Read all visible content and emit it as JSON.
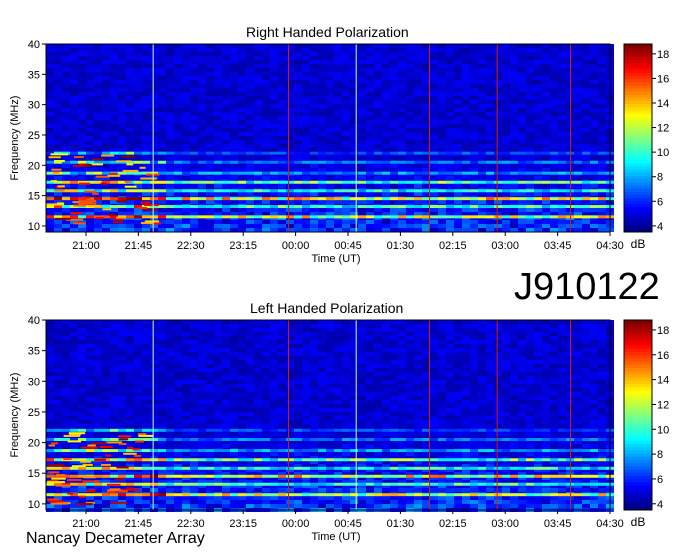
{
  "observation_id": "J910122",
  "instrument": "Nancay Decameter Array",
  "colorbar_unit": "dB",
  "chart_data": [
    {
      "type": "heatmap",
      "title": "Right Handed Polarization",
      "xlabel": "Time (UT)",
      "ylabel": "Frequency (MHz)",
      "x_ticks": [
        "21:00",
        "21:45",
        "22:30",
        "23:15",
        "00:00",
        "00:45",
        "01:30",
        "02:15",
        "03:00",
        "03:45",
        "04:30"
      ],
      "y_ticks": [
        10,
        15,
        20,
        25,
        30,
        35,
        40
      ],
      "ylim": [
        9,
        40
      ],
      "colorbar_ticks": [
        4,
        6,
        8,
        10,
        12,
        14,
        16,
        18
      ],
      "colorbar_range": [
        3.5,
        18.8
      ]
    },
    {
      "type": "heatmap",
      "title": "Left Handed Polarization",
      "xlabel": "Time (UT)",
      "ylabel": "Frequency (MHz)",
      "x_ticks": [
        "21:00",
        "21:45",
        "22:30",
        "23:15",
        "00:00",
        "00:45",
        "01:30",
        "02:15",
        "03:00",
        "03:45",
        "04:30"
      ],
      "y_ticks": [
        10,
        15,
        20,
        25,
        30,
        35,
        40
      ],
      "ylim": [
        9,
        40
      ],
      "colorbar_ticks": [
        4,
        6,
        8,
        10,
        12,
        14,
        16,
        18
      ],
      "colorbar_range": [
        3.5,
        18.8
      ]
    }
  ]
}
